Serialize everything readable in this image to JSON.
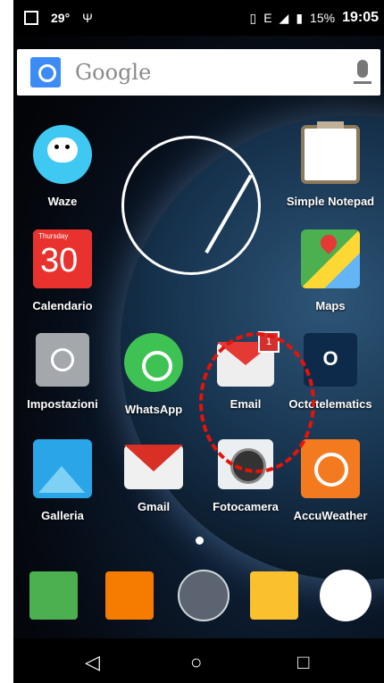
{
  "status_bar": {
    "temperature": "29°",
    "usb_symbol": "Ψ",
    "network": "E",
    "battery": "15%",
    "time": "19:05"
  },
  "search": {
    "placeholder": "Google"
  },
  "apps": {
    "waze": "Waze",
    "notepad": "Simple Notepad",
    "calendar": "Calendario",
    "calendar_day": "30",
    "calendar_weekday": "Thursday",
    "maps": "Maps",
    "settings": "Impostazioni",
    "whatsapp": "WhatsApp",
    "email": "Email",
    "email_badge": "1",
    "octo": "Octotelematics",
    "octo_letter": "O",
    "gallery": "Galleria",
    "gmail": "Gmail",
    "camera": "Fotocamera",
    "accuweather": "AccuWeather"
  },
  "nav": {
    "back": "◁",
    "home": "○",
    "recents": "□"
  }
}
